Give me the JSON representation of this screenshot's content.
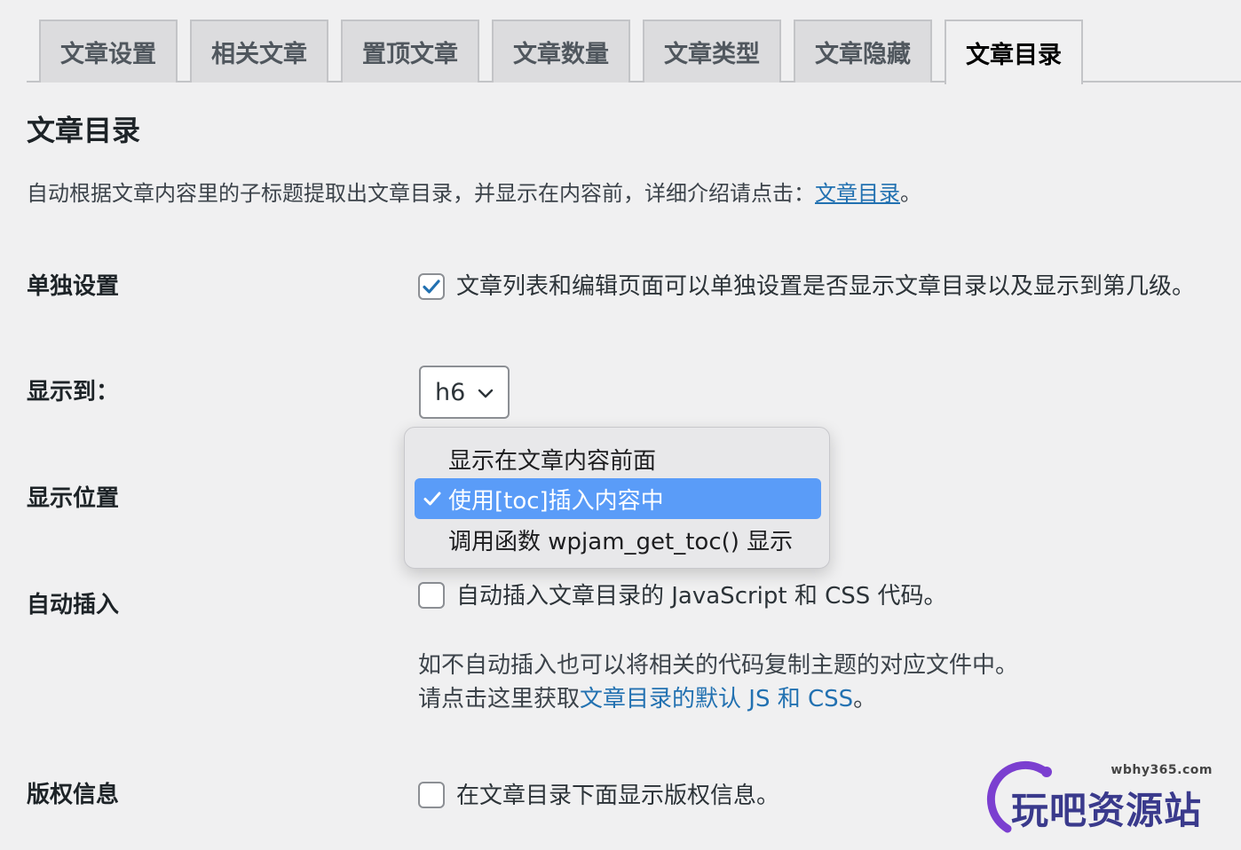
{
  "tabs": [
    {
      "label": "文章设置"
    },
    {
      "label": "相关文章"
    },
    {
      "label": "置顶文章"
    },
    {
      "label": "文章数量"
    },
    {
      "label": "文章类型"
    },
    {
      "label": "文章隐藏"
    },
    {
      "label": "文章目录"
    }
  ],
  "section": {
    "title": "文章目录",
    "description": "自动根据文章内容里的子标题提取出文章目录，并显示在内容前，详细介绍请点击：",
    "description_link": "文章目录",
    "description_end": "。"
  },
  "rows": {
    "single": {
      "label": "单独设置",
      "checked": true,
      "text": "文章列表和编辑页面可以单独设置是否显示文章目录以及显示到第几级。"
    },
    "depth": {
      "label": "显示到：",
      "value": "h6"
    },
    "position": {
      "label": "显示位置",
      "options": [
        "显示在文章内容前面",
        "使用[toc]插入内容中",
        "调用函数 wpjam_get_toc() 显示"
      ],
      "selected_index": 1
    },
    "auto": {
      "label": "自动插入",
      "checked": false,
      "text": "自动插入文章目录的 JavaScript 和 CSS 代码。",
      "note_line1": "如不自动插入也可以将相关的代码复制主题的对应文件中。",
      "note_line2": "请点击这里获取",
      "note_link": "文章目录的默认 JS 和 CSS",
      "note_end": "。"
    },
    "copyright": {
      "label": "版权信息",
      "checked": false,
      "text": "在文章目录下面显示版权信息。"
    }
  },
  "watermark": {
    "url": "wbhy365.com",
    "text": "玩吧资源站"
  },
  "colors": {
    "background": "#f0f0f1",
    "tab_inactive": "#dcdcde",
    "link": "#2271b1",
    "checkbox_check": "#2271b1",
    "dropdown_selected": "#5a9cf8"
  }
}
